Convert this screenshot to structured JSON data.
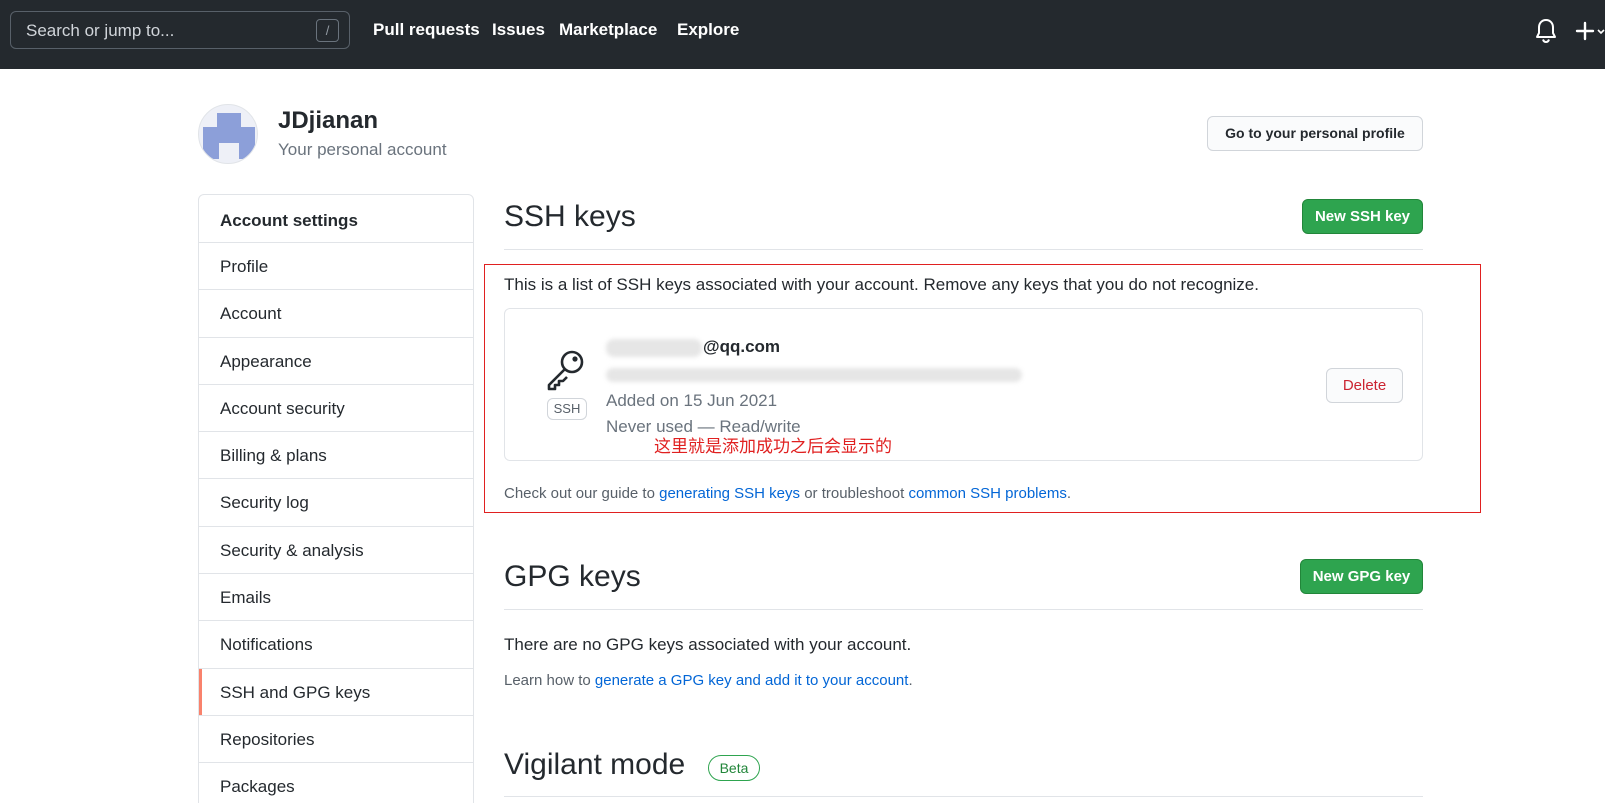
{
  "header": {
    "search_placeholder": "Search or jump to...",
    "search_shortcut": "/",
    "nav": [
      {
        "label": "Pull requests"
      },
      {
        "label": "Issues"
      },
      {
        "label": "Marketplace"
      },
      {
        "label": "Explore"
      }
    ],
    "icons": {
      "notifications": "bell-icon",
      "create": "plus-icon"
    }
  },
  "profile": {
    "username": "JDjianan",
    "subtitle": "Your personal account",
    "profile_button": "Go to your personal profile"
  },
  "sidebar": {
    "heading": "Account settings",
    "items": [
      {
        "label": "Profile"
      },
      {
        "label": "Account"
      },
      {
        "label": "Appearance"
      },
      {
        "label": "Account security"
      },
      {
        "label": "Billing & plans"
      },
      {
        "label": "Security log"
      },
      {
        "label": "Security & analysis"
      },
      {
        "label": "Emails"
      },
      {
        "label": "Notifications"
      },
      {
        "label": "SSH and GPG keys",
        "selected": true
      },
      {
        "label": "Repositories"
      },
      {
        "label": "Packages"
      }
    ]
  },
  "ssh": {
    "title": "SSH keys",
    "new_button": "New SSH key",
    "description": "This is a list of SSH keys associated with your account. Remove any keys that you do not recognize.",
    "key": {
      "type_label": "SSH",
      "title": "@qq.com",
      "added": "Added on 15 Jun 2021",
      "usage": "Never used — Read/write",
      "delete_button": "Delete"
    },
    "annotation": "这里就是添加成功之后会显示的",
    "guide": {
      "prefix": "Check out our guide to",
      "link1": "generating SSH keys",
      "middle": "or troubleshoot",
      "link2": "common SSH problems",
      "suffix": "."
    }
  },
  "gpg": {
    "title": "GPG keys",
    "new_button": "New GPG key",
    "empty": "There are no GPG keys associated with your account.",
    "learn_prefix": "Learn how to",
    "learn_link": "generate a GPG key and add it to your account",
    "learn_suffix": "."
  },
  "vigilant": {
    "title": "Vigilant mode",
    "badge": "Beta"
  },
  "colors": {
    "header_bg": "#24292e",
    "primary_green": "#2ea44f",
    "danger_red": "#cb2431",
    "link_blue": "#0366d6",
    "annotation_red": "#e02020",
    "selected_accent": "#f9826c"
  }
}
